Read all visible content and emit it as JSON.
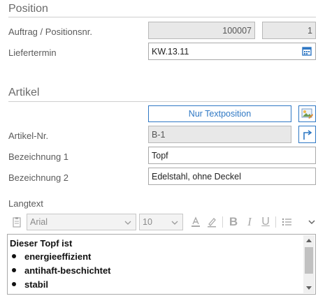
{
  "position": {
    "title": "Position",
    "auftrag_label": "Auftrag / Positionsnr.",
    "auftrag_value": "100007",
    "position_value": "1",
    "liefertermin_label": "Liefertermin",
    "liefertermin_value": "KW.13.11"
  },
  "artikel": {
    "title": "Artikel",
    "text_position_button": "Nur Textposition",
    "artikel_nr_label": "Artikel-Nr.",
    "artikel_nr_value": "B-1",
    "bezeichnung1_label": "Bezeichnung 1",
    "bezeichnung1_value": "Topf",
    "bezeichnung2_label": "Bezeichnung 2",
    "bezeichnung2_value": "Edelstahl, ohne Deckel"
  },
  "langtext": {
    "label": "Langtext",
    "font": "Arial",
    "font_size": "10",
    "content_heading": "Dieser Topf ist",
    "bullets": [
      "energieeffizient",
      "antihaft-beschichtet",
      "stabil"
    ]
  },
  "colors": {
    "accent": "#2f78c4",
    "readonly_bg": "#e8e8e8",
    "calendar_icon": "#2f78c4"
  },
  "icons": [
    "calendar-icon",
    "picture-icon",
    "jump-arrow-icon",
    "paste-icon",
    "chevron-down-icon",
    "font-color-icon",
    "highlighter-icon",
    "bold-icon",
    "italic-icon",
    "underline-icon",
    "list-icon",
    "expand-chevron-icon"
  ]
}
